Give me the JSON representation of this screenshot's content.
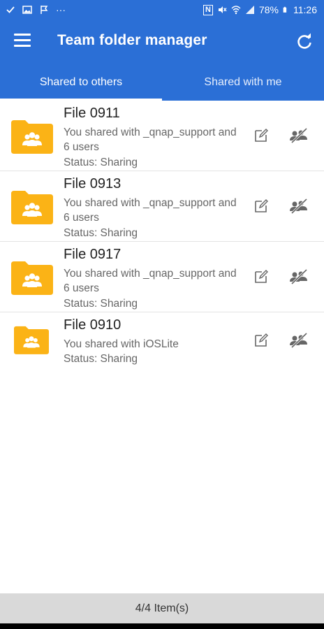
{
  "status_bar": {
    "icons_left": [
      "check-icon",
      "image-icon",
      "flag-icon",
      "more-dots-icon"
    ],
    "dots": "···",
    "nfc": "N",
    "battery_percent": "78%",
    "time": "11:26"
  },
  "app_bar": {
    "title": "Team folder manager",
    "menu_icon": "hamburger-menu-icon",
    "refresh_icon": "refresh-icon"
  },
  "tabs": [
    {
      "label": "Shared to others",
      "active": true
    },
    {
      "label": "Shared with me",
      "active": false
    }
  ],
  "colors": {
    "primary": "#2b6fd6",
    "folder": "#fbb316",
    "footer_bg": "#d9d9d9"
  },
  "items": [
    {
      "name": "File 0911",
      "shared": "You shared with _qnap_support and 6 users",
      "status": "Status: Sharing"
    },
    {
      "name": "File 0913",
      "shared": "You shared with _qnap_support and 6 users",
      "status": "Status: Sharing"
    },
    {
      "name": "File 0917",
      "shared": "You shared with _qnap_support and 6 users",
      "status": "Status: Sharing"
    },
    {
      "name": "File 0910",
      "shared": "You shared with iOSLite",
      "status": "Status: Sharing"
    }
  ],
  "footer": {
    "count": "4/4 Item(s)"
  }
}
